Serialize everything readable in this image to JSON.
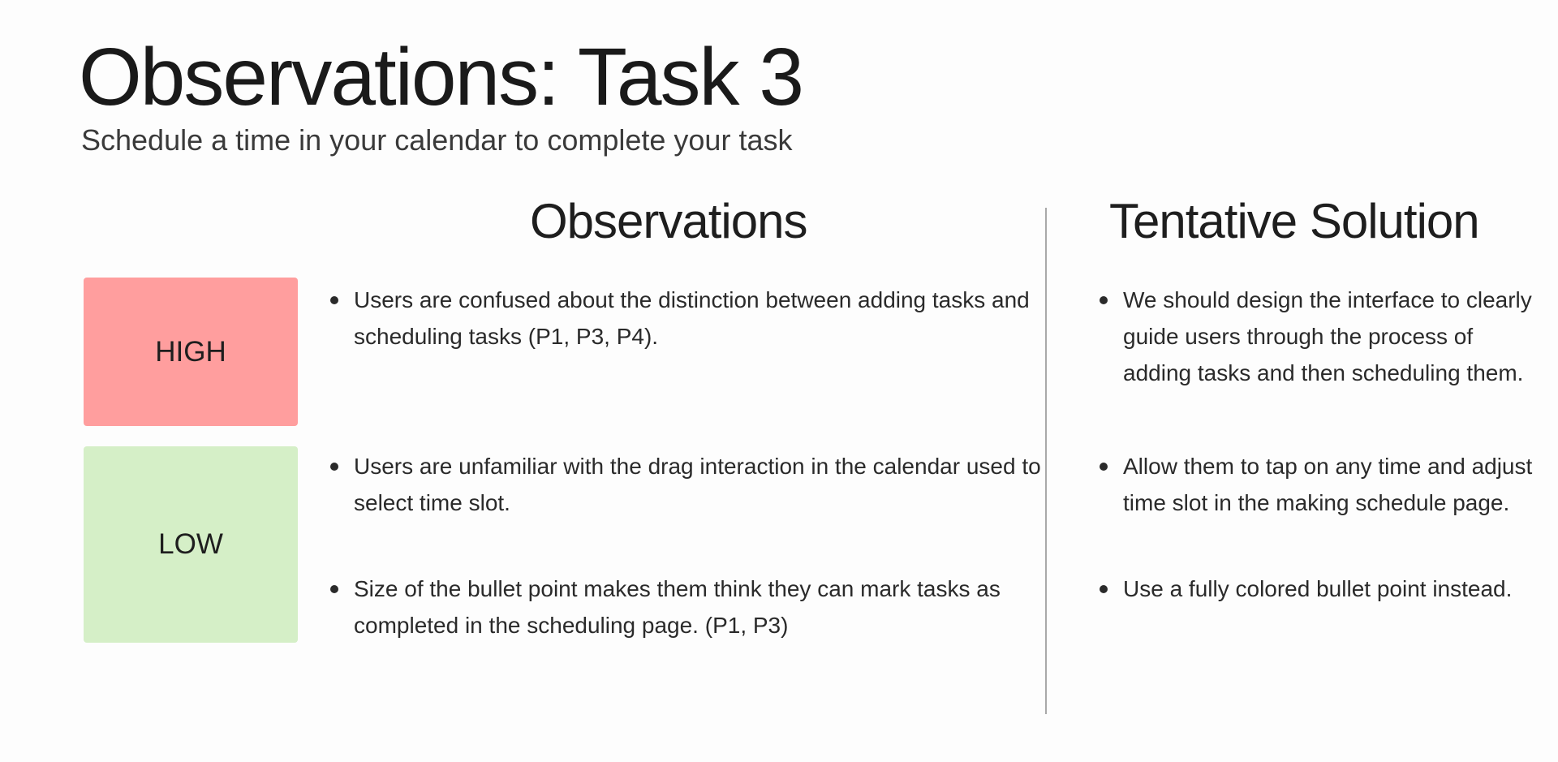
{
  "slide": {
    "title": "Observations: Task 3",
    "subtitle": "Schedule a time in your calendar to complete your task"
  },
  "columns": {
    "observations_heading": "Observations",
    "solution_heading": "Tentative Solution"
  },
  "priorities": {
    "high": {
      "label": "HIGH",
      "color": "#ff9e9e"
    },
    "low": {
      "label": "LOW",
      "color": "#d5efc7"
    }
  },
  "observations": [
    "Users are confused about the distinction between adding tasks and scheduling tasks (P1, P3, P4).",
    "Users are unfamiliar with the drag interaction in the calendar used to select time slot.",
    "Size of the bullet point makes them think they can mark tasks as completed in the scheduling page. (P1, P3)"
  ],
  "solutions": [
    "We should design the interface to clearly guide users through the process of adding tasks and then scheduling them.",
    "Allow them to tap on any time and adjust time slot in the making schedule page.",
    "Use a fully colored bullet point instead."
  ]
}
